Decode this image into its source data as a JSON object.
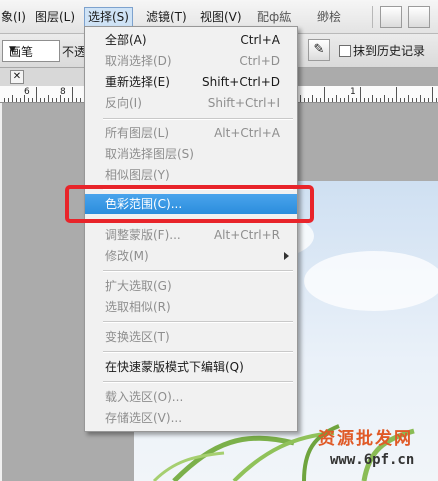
{
  "menubar": {
    "items": [
      "象(I)",
      "图层(L)",
      "选择(S)",
      "滤镜(T)",
      "视图(V)",
      "窗口(W)",
      "帮助(H)"
    ],
    "active_index": 2,
    "overlay_text_1": "配ф紘",
    "overlay_text_2": "缈桧"
  },
  "optionsbar": {
    "brush_preset": "画笔",
    "opacity_label": "不透",
    "history_label": "抹到历史记录"
  },
  "ruler": {
    "numbers": [
      "6",
      "8",
      "1"
    ]
  },
  "select_menu": {
    "items": [
      {
        "label": "全部(A)",
        "shortcut": "Ctrl+A",
        "disabled": false
      },
      {
        "label": "取消选择(D)",
        "shortcut": "Ctrl+D",
        "disabled": true
      },
      {
        "label": "重新选择(E)",
        "shortcut": "Shift+Ctrl+D",
        "disabled": false
      },
      {
        "label": "反向(I)",
        "shortcut": "Shift+Ctrl+I",
        "disabled": true
      },
      {
        "label": "所有图层(L)",
        "shortcut": "Alt+Ctrl+A",
        "disabled": true
      },
      {
        "label": "取消选择图层(S)",
        "shortcut": "",
        "disabled": true
      },
      {
        "label": "相似图层(Y)",
        "shortcut": "",
        "disabled": true
      },
      {
        "label": "色彩范围(C)...",
        "shortcut": "",
        "disabled": false,
        "highlighted": true
      },
      {
        "label": "调整蒙版(F)...",
        "shortcut": "Alt+Ctrl+R",
        "disabled": true
      },
      {
        "label": "修改(M)",
        "shortcut": "",
        "disabled": true,
        "submenu": true
      },
      {
        "label": "扩大选取(G)",
        "shortcut": "",
        "disabled": true
      },
      {
        "label": "选取相似(R)",
        "shortcut": "",
        "disabled": true
      },
      {
        "label": "变换选区(T)",
        "shortcut": "",
        "disabled": true
      },
      {
        "label": "在快速蒙版模式下编辑(Q)",
        "shortcut": "",
        "disabled": false
      },
      {
        "label": "载入选区(O)...",
        "shortcut": "",
        "disabled": true
      },
      {
        "label": "存储选区(V)...",
        "shortcut": "",
        "disabled": true
      }
    ]
  },
  "watermark": {
    "line1": "资源批发网",
    "line2": "www.6pf.cn"
  },
  "colors": {
    "highlight": "#3796e4",
    "callout": "#e8242a"
  }
}
